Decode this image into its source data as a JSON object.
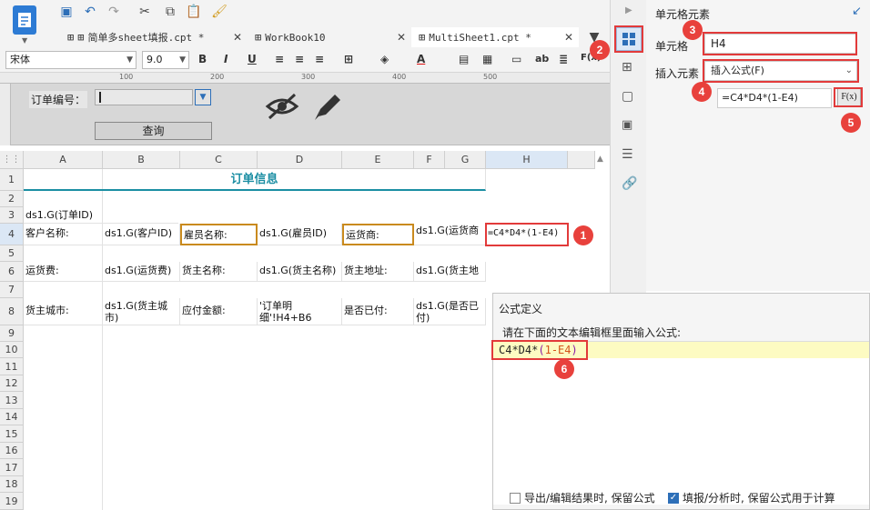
{
  "toolbar": {
    "tabs": [
      {
        "label": "简单多sheet填报.cpt *",
        "active": false
      },
      {
        "label": "WorkBook10",
        "active": false
      },
      {
        "label": "MultiSheet1.cpt *",
        "active": true
      }
    ],
    "font_name": "宋体",
    "font_size": "9.0"
  },
  "param_panel": {
    "order_no_label": "订单编号：",
    "query_button": "查询"
  },
  "grid": {
    "columns": [
      "A",
      "B",
      "C",
      "D",
      "E",
      "F",
      "G",
      "H"
    ],
    "rows": [
      "1",
      "2",
      "3",
      "4",
      "5",
      "6",
      "7",
      "8",
      "9",
      "10",
      "11",
      "12",
      "13",
      "14",
      "15",
      "16",
      "17",
      "18",
      "19"
    ],
    "cells": {
      "title": "订单信息",
      "a3": "ds1.G(订单ID)",
      "a4": "客户名称:",
      "b4": "ds1.G(客户ID)",
      "c4": "雇员名称:",
      "d4": "ds1.G(雇员ID)",
      "e4": "运货商:",
      "f4": "ds1.G(运货商",
      "h4": "=C4*D4*(1-E4)",
      "a6": "运货费:",
      "b6": "ds1.G(运货费)",
      "c6": "货主名称:",
      "d6": "ds1.G(货主名称)",
      "e6": "货主地址:",
      "f6": "ds1.G(货主地",
      "a8": "货主城市:",
      "b8": "ds1.G(货主城市)",
      "c8": "应付金额:",
      "d8": "'订单明细'!H4+B6",
      "e8": "是否已付:",
      "f8": "ds1.G(是否已付)"
    }
  },
  "right_panel": {
    "title": "单元格元素",
    "cell_label": "单元格",
    "cell_value": "H4",
    "insert_label": "插入元素",
    "insert_value": "插入公式(F)",
    "formula_value": "=C4*D4*(1-E4)",
    "fx_label": "F(x)"
  },
  "formula_dialog": {
    "title": "公式定义",
    "prompt": "请在下面的文本编辑框里面输入公式:",
    "formula_part1": "C4*D4*",
    "formula_part2": "(",
    "formula_part3": "1-E4",
    "formula_part4": ")",
    "opt_export": "导出/编辑结果时, 保留公式",
    "opt_fill": "填报/分析时, 保留公式用于计算",
    "opt_export_checked": false,
    "opt_fill_checked": true
  },
  "badges": [
    "1",
    "2",
    "3",
    "4",
    "5",
    "6"
  ],
  "ruler_marks": [
    "100",
    "200",
    "300",
    "400",
    "500"
  ],
  "colors": {
    "accent": "#2d7bd4",
    "badge": "#e8413c",
    "highlight": "#e23a3a",
    "title_teal": "#1b8ea3",
    "formula_bg": "#fdfbc2"
  }
}
